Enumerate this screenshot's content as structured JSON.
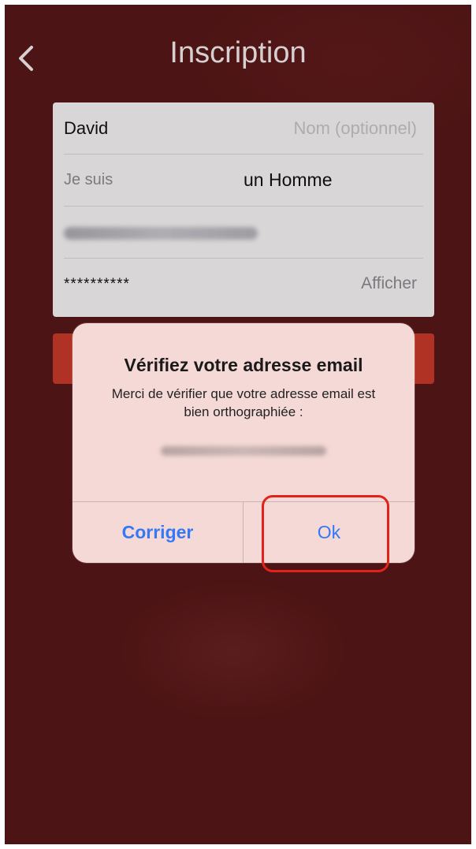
{
  "navbar": {
    "back_icon": "chevron-left-icon",
    "title": "Inscription"
  },
  "form": {
    "first_name": "David",
    "last_name_placeholder": "Nom (optionnel)",
    "gender_label": "Je suis",
    "gender_value": "un Homme",
    "password_mask": "**********",
    "show_password": "Afficher"
  },
  "alert": {
    "title": "Vérifiez votre adresse email",
    "message": "Merci de vérifier que votre adresse email est bien orthographiée :",
    "correct_label": "Corriger",
    "ok_label": "Ok"
  },
  "colors": {
    "background": "#551718",
    "submit": "#c63a2a",
    "alert_bg": "#f5d9d6",
    "button_text": "#3478f6",
    "highlight": "#e2231a"
  }
}
